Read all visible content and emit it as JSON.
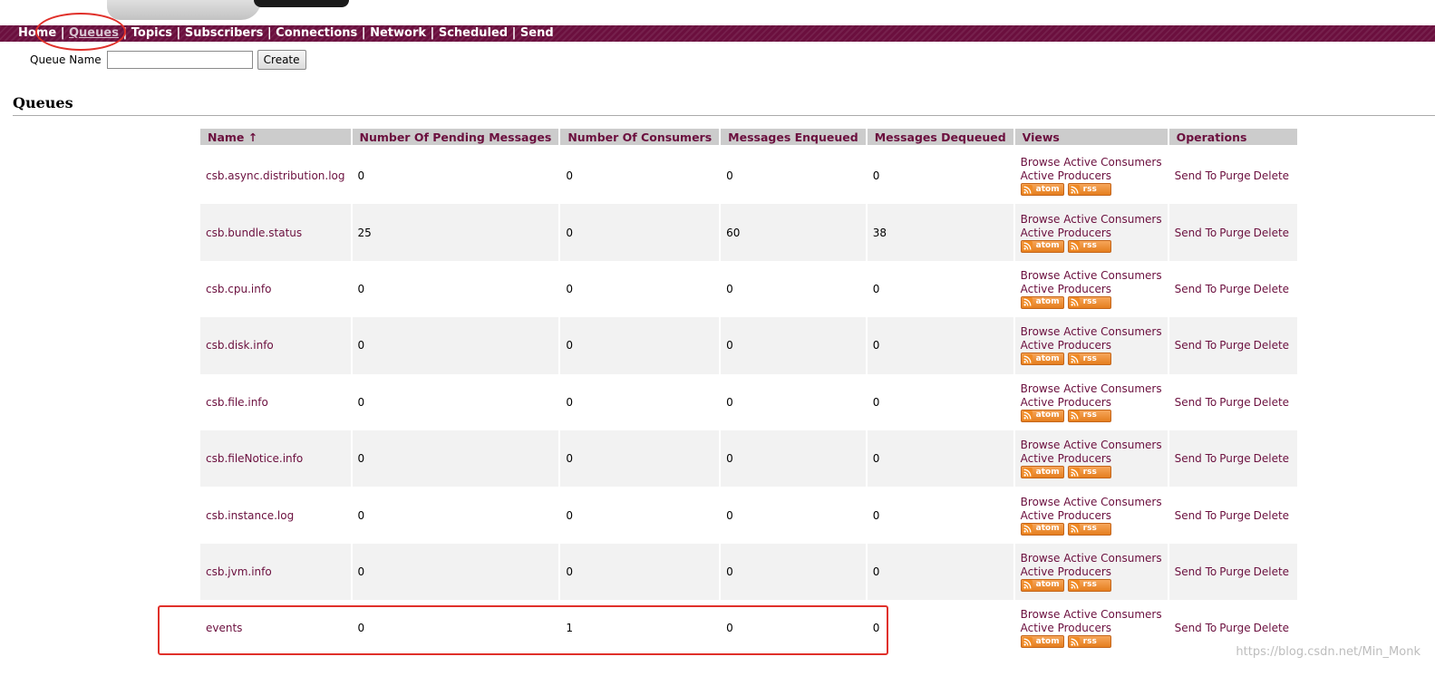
{
  "nav": {
    "items": [
      "Home",
      "Queues",
      "Topics",
      "Subscribers",
      "Connections",
      "Network",
      "Scheduled",
      "Send"
    ],
    "separator": "|",
    "active": "Queues"
  },
  "create_form": {
    "label": "Queue Name",
    "input_value": "",
    "button_label": "Create"
  },
  "section": {
    "title": "Queues"
  },
  "table": {
    "columns": [
      "Name ↑",
      "Number Of Pending Messages",
      "Number Of Consumers",
      "Messages Enqueued",
      "Messages Dequeued",
      "Views",
      "Operations"
    ],
    "views": {
      "browse": "Browse",
      "active_consumers": "Active Consumers",
      "active_producers": "Active Producers",
      "atom": "atom",
      "rss": "rss"
    },
    "operations": {
      "send_to": "Send To",
      "purge": "Purge",
      "delete": "Delete"
    },
    "rows": [
      {
        "name": "csb.async.distribution.log",
        "pending": "0",
        "consumers": "0",
        "enqueued": "0",
        "dequeued": "0"
      },
      {
        "name": "csb.bundle.status",
        "pending": "25",
        "consumers": "0",
        "enqueued": "60",
        "dequeued": "38"
      },
      {
        "name": "csb.cpu.info",
        "pending": "0",
        "consumers": "0",
        "enqueued": "0",
        "dequeued": "0"
      },
      {
        "name": "csb.disk.info",
        "pending": "0",
        "consumers": "0",
        "enqueued": "0",
        "dequeued": "0"
      },
      {
        "name": "csb.file.info",
        "pending": "0",
        "consumers": "0",
        "enqueued": "0",
        "dequeued": "0"
      },
      {
        "name": "csb.fileNotice.info",
        "pending": "0",
        "consumers": "0",
        "enqueued": "0",
        "dequeued": "0"
      },
      {
        "name": "csb.instance.log",
        "pending": "0",
        "consumers": "0",
        "enqueued": "0",
        "dequeued": "0"
      },
      {
        "name": "csb.jvm.info",
        "pending": "0",
        "consumers": "0",
        "enqueued": "0",
        "dequeued": "0"
      },
      {
        "name": "events",
        "pending": "0",
        "consumers": "1",
        "enqueued": "0",
        "dequeued": "0"
      }
    ]
  },
  "watermark": "https://blog.csdn.net/Min_Monk",
  "colors": {
    "nav_bg": "#6b0f3e",
    "link": "#6b0f3e",
    "header_bg": "#cccccc",
    "row_alt": "#f2f2f2",
    "annotation": "#e0302a",
    "feed_orange": "#e57e1f"
  }
}
